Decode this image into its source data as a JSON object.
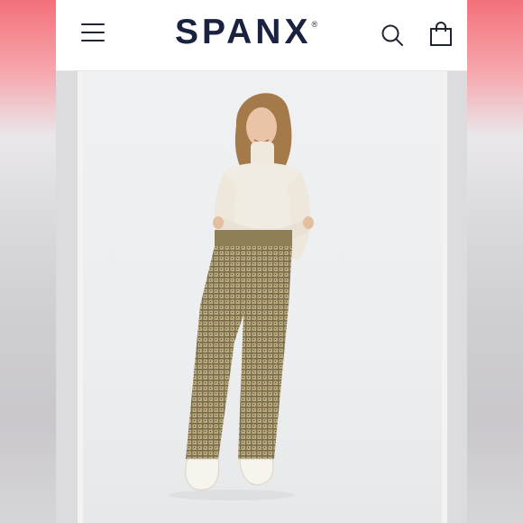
{
  "header": {
    "brand": "SPANX",
    "trademark": "®",
    "icons": [
      "menu-icon",
      "search-icon",
      "shopping-bag-icon"
    ]
  },
  "colors": {
    "brand_navy": "#1a2240",
    "side_pink": "#f4707a",
    "gallery_bg": "#eef0f2"
  }
}
